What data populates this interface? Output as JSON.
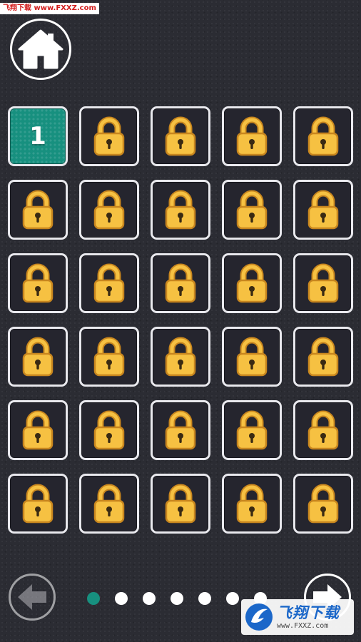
{
  "watermark": {
    "top_text": "飞翔下载 www.FXXZ.com",
    "bottom_title": "飞翔下载",
    "bottom_url": "www.FXXZ.com"
  },
  "home_button": {
    "icon": "home-icon"
  },
  "levels": {
    "rows": 6,
    "columns": 5,
    "unlocked_level_label": "1",
    "locked_icon": "padlock-icon",
    "colors": {
      "unlocked_tile": "#17907f",
      "locked_tile": "#25252e",
      "tile_border": "#e9e9ee",
      "padlock_body": "#f6c142",
      "padlock_outline": "#c8861e"
    }
  },
  "pagination": {
    "total_pages": 7,
    "current_page": 1,
    "active_color": "#17907f",
    "inactive_color": "#ffffff"
  },
  "navigation": {
    "prev_icon": "arrow-left-icon",
    "next_icon": "arrow-right-icon"
  }
}
